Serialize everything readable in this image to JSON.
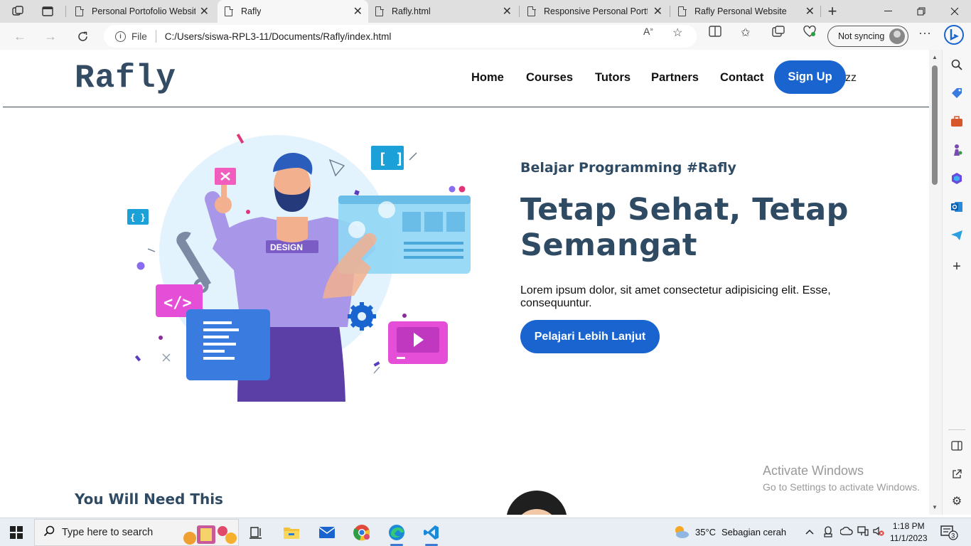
{
  "browser": {
    "tabs": [
      {
        "title": "Personal Portofolio Website",
        "active": false
      },
      {
        "title": "Rafly",
        "active": true
      },
      {
        "title": "Rafly.html",
        "active": false
      },
      {
        "title": "Responsive Personal Portfolio",
        "active": false
      },
      {
        "title": "Rafly Personal Website",
        "active": false
      }
    ],
    "address": {
      "scheme_label": "File",
      "url": "C:/Users/siswa-RPL3-11/Documents/Rafly/index.html"
    },
    "sync_label": "Not syncing"
  },
  "site": {
    "logo": "Rafly",
    "nav": [
      "Home",
      "Courses",
      "Tutors",
      "Partners",
      "Contact"
    ],
    "signup": "Sign Up",
    "overflow_text": "zz",
    "hero": {
      "kicker": "Belajar Programming #Rafly",
      "headline": "Tetap Sehat, Tetap Semangat",
      "body": "Lorem ipsum dolor, sit amet consectetur adipisicing elit. Esse, consequuntur.",
      "cta": "Pelajari Lebih Lanjut",
      "illustration_badge": "DESIGN"
    },
    "section2_title": "You Will Need This"
  },
  "watermark": {
    "line1": "Activate Windows",
    "line2": "Go to Settings to activate Windows."
  },
  "taskbar": {
    "search_placeholder": "Type here to search",
    "weather_temp": "35°C",
    "weather_desc": "Sebagian cerah",
    "time": "1:18 PM",
    "date": "11/1/2023",
    "notification_count": "3"
  },
  "colors": {
    "brand_blue": "#1a64d0",
    "heading_navy": "#2f4a63",
    "logo_slate": "#334b63"
  }
}
